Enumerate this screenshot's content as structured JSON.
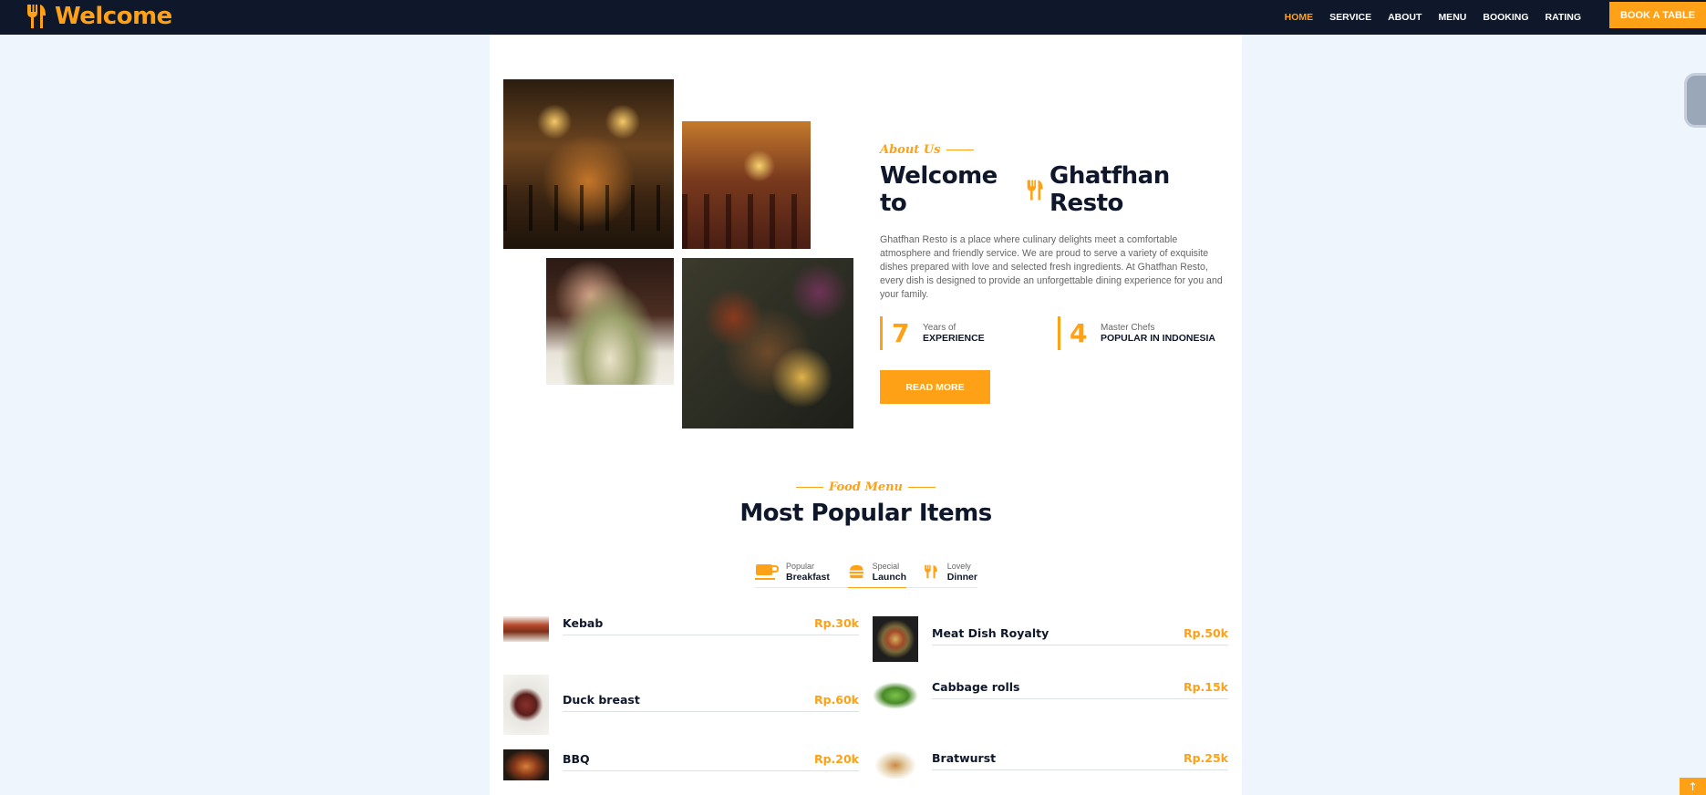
{
  "navbar": {
    "brand": "Welcome",
    "links": [
      "HOME",
      "SERVICE",
      "ABOUT",
      "MENU",
      "BOOKING",
      "RATING"
    ],
    "active": "HOME",
    "book_button": "BOOK A TABLE"
  },
  "about": {
    "subtitle": "About Us",
    "title_prefix": "Welcome to",
    "title_name": "Ghatfhan Resto",
    "text": "Ghatfhan Resto is a place where culinary delights meet a comfortable atmosphere and friendly service. We are proud to serve a variety of exquisite dishes prepared with love and selected fresh ingredients. At Ghatfhan Resto, every dish is designed to provide an unforgettable dining experience for you and your family.",
    "stats": [
      {
        "number": "7",
        "label": "Years of",
        "value": "EXPERIENCE"
      },
      {
        "number": "4",
        "label": "Master Chefs",
        "value": "POPULAR IN INDONESIA"
      }
    ],
    "read_more": "READ MORE"
  },
  "menu": {
    "subtitle": "Food Menu",
    "title": "Most Popular Items",
    "tabs": [
      {
        "small": "Popular",
        "big": "Breakfast",
        "icon": "coffee-icon"
      },
      {
        "small": "Special",
        "big": "Launch",
        "icon": "hamburger-icon"
      },
      {
        "small": "Lovely",
        "big": "Dinner",
        "icon": "utensils-icon"
      }
    ],
    "active_tab": "Launch",
    "items_left": [
      {
        "name": "Kebab",
        "price": "Rp.30k"
      },
      {
        "name": "Duck breast",
        "price": "Rp.60k"
      },
      {
        "name": "BBQ",
        "price": "Rp.20k"
      }
    ],
    "items_right": [
      {
        "name": "Meat Dish Royalty",
        "price": "Rp.50k"
      },
      {
        "name": "Cabbage rolls",
        "price": "Rp.15k"
      },
      {
        "name": "Bratwurst",
        "price": "Rp.25k"
      }
    ]
  },
  "colors": {
    "primary": "#fea116",
    "dark": "#0f172b",
    "background": "#eef5fd"
  }
}
